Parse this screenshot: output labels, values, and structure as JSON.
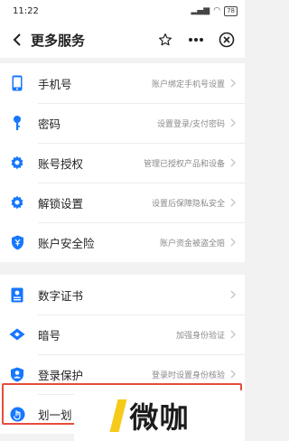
{
  "status_bar": {
    "time": "11:22",
    "battery": "78"
  },
  "nav": {
    "title": "更多服务"
  },
  "group1": [
    {
      "id": "phone",
      "label": "手机号",
      "desc": "账户绑定手机号设置",
      "icon": "phone-icon"
    },
    {
      "id": "password",
      "label": "密码",
      "desc": "设置登录/支付密码",
      "icon": "key-icon"
    },
    {
      "id": "auth",
      "label": "账号授权",
      "desc": "管理已授权产品和设备",
      "icon": "gear-icon"
    },
    {
      "id": "unlock",
      "label": "解锁设置",
      "desc": "设置后保障隐私安全",
      "icon": "gear-icon"
    },
    {
      "id": "insurance",
      "label": "账户安全险",
      "desc": "账户资金被盗全赔",
      "icon": "shield-yen-icon"
    }
  ],
  "group2": [
    {
      "id": "cert",
      "label": "数字证书",
      "desc": "",
      "icon": "certificate-icon"
    },
    {
      "id": "code",
      "label": "暗号",
      "desc": "加强身份验证",
      "icon": "diamond-icon"
    },
    {
      "id": "protect",
      "label": "登录保护",
      "desc": "登录时设置身份核验",
      "icon": "user-shield-icon"
    },
    {
      "id": "swipe",
      "label": "划一划",
      "desc": "",
      "icon": "swipe-icon"
    }
  ],
  "colors": {
    "accent": "#1677ff",
    "highlight": "#e74c3c",
    "watermark_accent": "#f5c400"
  },
  "watermark": {
    "text": "微咖"
  }
}
